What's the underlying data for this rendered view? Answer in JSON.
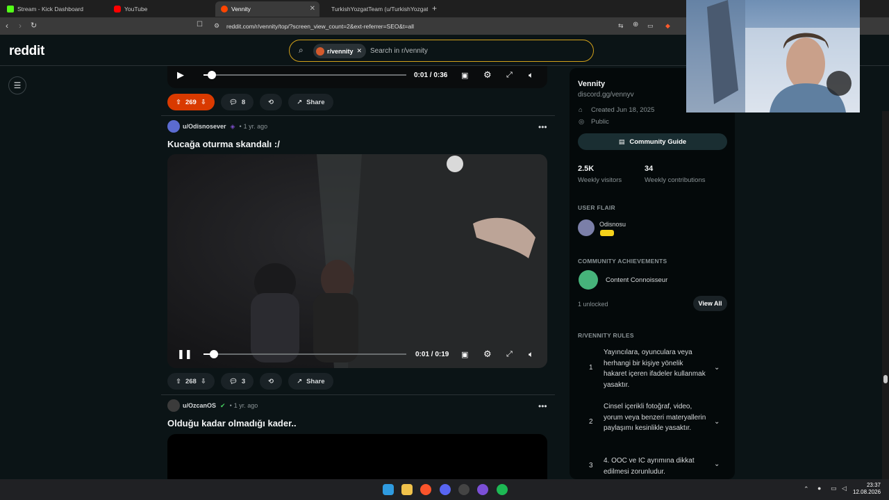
{
  "browser": {
    "tabs": [
      {
        "label": "Stream - Kick Dashboard",
        "color": "#53fc18"
      },
      {
        "label": "YouTube",
        "color": "#ff0000"
      },
      {
        "label": "Vennity",
        "color": "#ff4500"
      },
      {
        "label": "TurkishYozgatTeam (u/TurkishYozgat",
        "color": "#ff4500"
      }
    ],
    "new_tab": "+",
    "url": "reddit.com/r/vennity/top/?screen_view_count=2&ext-referrer=SEO&t=all"
  },
  "header": {
    "logo": "reddit",
    "search": {
      "chip": "r/vennity",
      "placeholder": "Search in r/vennity"
    }
  },
  "feed": {
    "top_video": {
      "time": "0:01 / 0:36",
      "progress": 0.04
    },
    "top_actions": {
      "votes": "269",
      "comments": "8",
      "share": "Share"
    },
    "post1": {
      "author": "u/Odisnosever",
      "age": "1 yr. ago",
      "title": "Kucağa oturma skandalı :/",
      "video": {
        "time": "0:01 / 0:19",
        "progress": 0.05
      },
      "votes": "268",
      "comments": "3",
      "share": "Share"
    },
    "post2": {
      "author": "u/OzcanOS",
      "age": "1 yr. ago",
      "title": "Olduğu kadar olmadığı kader.."
    }
  },
  "sidebar": {
    "name": "Vennity",
    "link": "discord.gg/vennyv",
    "created": "Created Jun 18, 2025",
    "visibility": "Public",
    "guide_button": "Community Guide",
    "stats": [
      {
        "value": "2.5K",
        "label": "Weekly visitors"
      },
      {
        "value": "34",
        "label": "Weekly contributions"
      }
    ],
    "user_flair_heading": "USER FLAIR",
    "flair_user": "Odisnosu",
    "achievements_heading": "COMMUNITY ACHIEVEMENTS",
    "achievement": "Content Connoisseur",
    "unlocked": "1 unlocked",
    "view_all": "View All",
    "rules_heading": "R/VENNITY RULES",
    "rules": [
      {
        "num": "1",
        "text": "Yayıncılara, oyunculara veya herhangi bir kişiye yönelik hakaret içeren ifadeler kullanmak yasaktır."
      },
      {
        "num": "2",
        "text": "Cinsel içerikli fotoğraf, video, yorum veya benzeri materyallerin paylaşımı kesinlikle yasaktır."
      },
      {
        "num": "3",
        "text": "4. OOC ve IC ayrımına dikkat edilmesi zorunludur."
      }
    ]
  },
  "taskbar": {
    "time": "23:37",
    "date": "12.08.2026"
  }
}
